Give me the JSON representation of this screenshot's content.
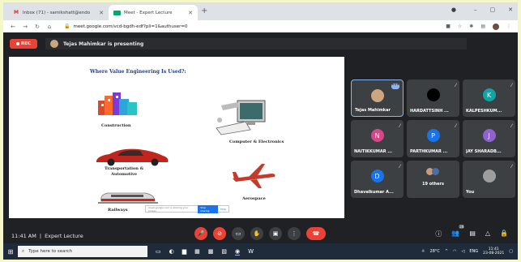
{
  "browser": {
    "tabs": [
      {
        "title": "Inbox (71) - samikshatt@endo",
        "active": false
      },
      {
        "title": "Meet - Expert Lecture",
        "active": true
      }
    ],
    "new_tab": "+",
    "url": "meet.google.com/vcd-bgdh-edf?pli=1&authuser=0",
    "window_controls": {
      "minimize": "–",
      "maximize": "▢",
      "close": "✕",
      "account": "●"
    }
  },
  "meet": {
    "rec_label": "REC",
    "presenting_text": "Tejas Mahimkar is presenting",
    "slide": {
      "title": "Where Value Engineering Is Used?:",
      "labels": {
        "construction": "Construction",
        "computer": "Computer & Electronics",
        "transport": "Transportation &\nAutomotive",
        "aerospace": "Aerospace",
        "railways": "Railways"
      },
      "share_prompt": {
        "text": "meet.google.com is sharing your screen.",
        "stop": "Stop sharing",
        "hide": "Hide"
      }
    },
    "participants": [
      {
        "name": "Tejas Mahimkar",
        "initial": "",
        "color": "#caa77e",
        "active": true,
        "more": "•••"
      },
      {
        "name": "HARDATTSINH ...",
        "initial": "",
        "color": "#000000",
        "active": false
      },
      {
        "name": "KALPESHKUM...",
        "initial": "K",
        "color": "#12a4a4",
        "active": false
      },
      {
        "name": "NAITIKKUMAR ...",
        "initial": "N",
        "color": "#d6478a",
        "active": false
      },
      {
        "name": "PARTHKUMAR ...",
        "initial": "P",
        "color": "#1a73e8",
        "active": false
      },
      {
        "name": "JAY SHARADB...",
        "initial": "J",
        "color": "#8e63ce",
        "active": false
      },
      {
        "name": "Dhavalkumar A...",
        "initial": "D",
        "color": "#1a73e8",
        "active": false
      },
      {
        "name": "19 others",
        "initial": "",
        "color": "",
        "active": false
      },
      {
        "name": "You",
        "initial": "",
        "color": "#9e9e9e",
        "active": false
      }
    ],
    "meeting_time": "11:41 AM",
    "meeting_separator": "|",
    "meeting_name": "Expert Lecture",
    "people_count": "28"
  },
  "taskbar": {
    "search_placeholder": "Type here to search",
    "weather": "28°C",
    "language": "ENG",
    "time": "11:41",
    "date": "23-08-2021"
  }
}
